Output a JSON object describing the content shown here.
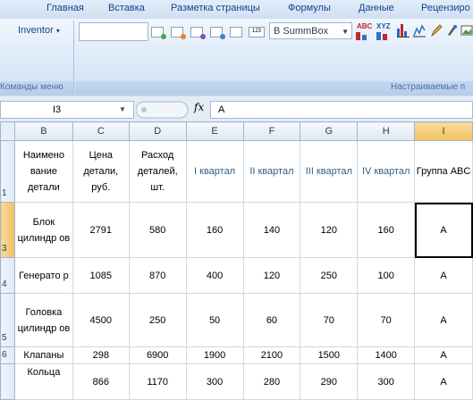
{
  "ribbon_tabs": [
    "Главная",
    "Вставка",
    "Разметка страницы",
    "Формулы",
    "Данные",
    "Рецензиро"
  ],
  "ribbon": {
    "inventor_label": "Inventor",
    "font_combo_value": "B SummBox",
    "group_commands_caption": "Команды меню",
    "group_custom_caption": "Настраиваемые п",
    "icon_abc": "ABC",
    "icon_xyz": "XYZ"
  },
  "formula_bar": {
    "name_box": "I3",
    "fx_label": "fx",
    "formula": "A"
  },
  "columns": [
    "B",
    "C",
    "D",
    "E",
    "F",
    "G",
    "H",
    "I"
  ],
  "header_row": {
    "row_number": "1",
    "cells": [
      "Наимено вание детали",
      "Цена детали, руб.",
      "Расход деталей, шт.",
      "I квартал",
      "II квартал",
      "III квартал",
      "IV квартал",
      "Группа ABC"
    ]
  },
  "rows": [
    {
      "row_number": "3",
      "cells": [
        "Блок цилиндр ов",
        "2791",
        "580",
        "160",
        "140",
        "120",
        "160",
        "A"
      ]
    },
    {
      "row_number": "4",
      "cells": [
        "Генерато р",
        "1085",
        "870",
        "400",
        "120",
        "250",
        "100",
        "A"
      ]
    },
    {
      "row_number": "5",
      "cells": [
        "Головка цилиндр ов",
        "4500",
        "250",
        "50",
        "60",
        "70",
        "70",
        "A"
      ]
    },
    {
      "row_number": "6",
      "cells": [
        "Клапаны",
        "298",
        "6900",
        "1900",
        "2100",
        "1500",
        "1400",
        "A"
      ]
    },
    {
      "row_number": "",
      "cells": [
        "Кольца",
        "866",
        "1170",
        "300",
        "280",
        "290",
        "300",
        "A"
      ]
    }
  ],
  "colors": {
    "accent": "#15428b",
    "selection": "#f1c15f"
  },
  "icons": [
    "dropdown-arrow-icon",
    "fx-icon",
    "chart-icon",
    "pen-icon"
  ]
}
